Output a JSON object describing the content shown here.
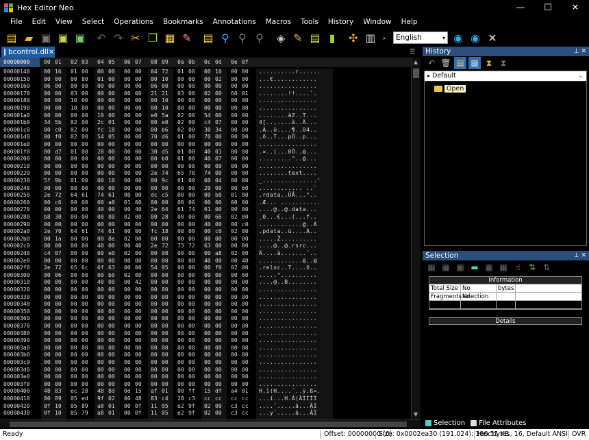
{
  "window": {
    "title": "Hex Editor Neo",
    "minimize": "—",
    "maximize": "☐",
    "close": "✕"
  },
  "menu": [
    "File",
    "Edit",
    "View",
    "Select",
    "Operations",
    "Bookmarks",
    "Annotations",
    "Macros",
    "Tools",
    "History",
    "Window",
    "Help"
  ],
  "toolbar": {
    "language": "English",
    "icons": [
      "new-file-icon",
      "open-folder-icon",
      "save-icon",
      "save-all-icon",
      "save-as-icon",
      "undo-icon",
      "redo-icon",
      "cut-icon",
      "copy-icon",
      "paste-icon",
      "erase-icon",
      "find-icon",
      "find-next-icon",
      "find-prev-icon",
      "replace-icon",
      "fill-icon",
      "edit-icon",
      "bookmark-icon",
      "goto-icon",
      "collapse-icon",
      "view-mode-icon",
      "language-icon",
      "globe-icon",
      "globe-update-icon",
      "settings-tools-icon"
    ]
  },
  "document": {
    "tab_label": "bcontrol.dll",
    "close": "✕"
  },
  "hex": {
    "header_offset": "00000000",
    "columns": [
      "00",
      "01",
      "02",
      "03",
      "04",
      "05",
      "06",
      "07",
      "08",
      "09",
      "0a",
      "0b",
      "0c",
      "0d",
      "0e",
      "0f"
    ],
    "rows": [
      {
        "o": "00000140",
        "b": "00 16 01 00 00 00 00 00 04 72 01 00 00 10 00 00",
        "a": "..........r......"
      },
      {
        "o": "00000150",
        "b": "00 00 00 80 01 00 00 00 00 10 00 00 00 02 00 00",
        "a": "...€............"
      },
      {
        "o": "00000160",
        "b": "06 00 00 00 00 00 00 00 06 00 00 00 00 00 00 00",
        "a": "................"
      },
      {
        "o": "00000170",
        "b": "00 00 03 00 00 00 00 00 21 21 03 00 02 00 60 01",
        "a": "........!!....`."
      },
      {
        "o": "00000180",
        "b": "00 00 10 00 00 00 00 00 00 10 00 00 00 00 00 00",
        "a": "................"
      },
      {
        "o": "00000190",
        "b": "00 00 10 00 00 00 00 00 00 10 00 00 00 00 00 00",
        "a": "................"
      },
      {
        "o": "000001a0",
        "b": "00 00 00 00 10 00 00 00 e0 5a 02 00 54 00 00 00",
        "a": "........àZ..T..."
      },
      {
        "o": "000001b0",
        "b": "34 5b 02 00 2c 01 00 00 00 e0 02 00 c4 07 00 00",
        "a": "4[..,....à..Ä..."
      },
      {
        "o": "000001c0",
        "b": "00 c0 02 00 fc 18 00 00 00 b6 02 00 30 34 00 00",
        "a": ".À..ü....¶..04.."
      },
      {
        "o": "000001d0",
        "b": "00 f0 02 00 54 05 00 00 70 d6 01 00 70 00 00 00",
        "a": ".ð..T...pÖ..p..."
      },
      {
        "o": "000001e0",
        "b": "00 00 00 00 00 00 00 00 00 00 00 00 00 00 00 00",
        "a": "................"
      },
      {
        "o": "000001f0",
        "b": "00 d7 01 00 28 00 00 00 30 d5 01 00 40 01 00 00",
        "a": ".×..(...0Õ..@..."
      },
      {
        "o": "00000200",
        "b": "00 00 00 00 00 00 00 00 00 b0 01 00 40 07 00 00",
        "a": ".........°..@..."
      },
      {
        "o": "00000210",
        "b": "00 00 00 00 00 00 00 00 00 00 00 00 00 00 00 00",
        "a": "................"
      },
      {
        "o": "00000220",
        "b": "00 00 00 00 00 00 00 00 2e 74 65 78 74 00 00 00",
        "a": "........text...."
      },
      {
        "o": "00000230",
        "b": "5f 9b 01 00 00 10 00 00 00 9c 01 00 00 04 00 00",
        "a": "_...............'"
      },
      {
        "o": "00000240",
        "b": "00 00 00 00 00 00 00 00 00 00 00 00 20 00 00 60",
        "a": "............ ..`"
      },
      {
        "o": "00000250",
        "b": "2e 72 64 61 74 61 00 00 dc c5 00 00 00 b0 01 00",
        "a": ".rdata..ÜÅ...°.."
      },
      {
        "o": "00000260",
        "b": "00 c6 00 00 00 a0 01 00 00 00 00 00 00 00 00 00",
        "a": ".Æ... ..........."
      },
      {
        "o": "00000270",
        "b": "00 00 00 00 40 00 00 40 2e 64 61 74 61 00 00 00",
        "a": "....@..@.data..."
      },
      {
        "o": "00000280",
        "b": "b8 30 00 00 00 80 02 00 00 28 00 00 00 66 02 00",
        "a": "¸0...€...(...f.."
      },
      {
        "o": "00000290",
        "b": "00 00 00 00 00 00 00 00 00 00 00 00 40 00 00 c0",
        "a": "............@..À"
      },
      {
        "o": "000002a0",
        "b": "2e 70 64 61 74 61 00 00 fc 18 00 00 00 c0 02 00",
        "a": ".pdata..ü....À.."
      },
      {
        "o": "000002b0",
        "b": "00 1a 00 00 00 8e 02 00 00 00 00 00 00 00 00 00",
        "a": ".....Ž.........."
      },
      {
        "o": "000002c0",
        "b": "00 00 00 00 40 00 00 40 2e 72 73 72 63 00 00 00",
        "a": "....@..@.rsrc..."
      },
      {
        "o": "000002d0",
        "b": "c4 07 00 00 00 e0 02 00 00 08 00 00 00 a8 02 00",
        "a": "Ä....à.......¨.."
      },
      {
        "o": "000002e0",
        "b": "00 00 00 00 00 00 00 00 00 00 00 00 40 00 00 40",
        "a": "............@..@"
      },
      {
        "o": "000002f0",
        "b": "2e 72 65 6c 6f 63 00 00 54 05 00 00 00 f0 02 00",
        "a": ".reloc..T....ð.."
      },
      {
        "o": "00000300",
        "b": "00 06 00 00 00 b0 02 00 00 00 00 00 00 00 00 00",
        "a": ".....°.........."
      },
      {
        "o": "00000310",
        "b": "00 00 00 00 40 00 00 42 00 00 00 00 00 00 00 00",
        "a": "....@..B........"
      },
      {
        "o": "00000320",
        "b": "00 00 00 00 00 00 00 00 00 00 00 00 00 00 00 00",
        "a": "................"
      },
      {
        "o": "00000330",
        "b": "00 00 00 00 00 00 00 00 00 00 00 00 00 00 00 00",
        "a": "................"
      },
      {
        "o": "00000340",
        "b": "00 00 00 00 00 00 00 00 00 00 00 00 00 00 00 00",
        "a": "................"
      },
      {
        "o": "00000350",
        "b": "00 00 00 00 00 00 00 00 00 00 00 00 00 00 00 00",
        "a": "................"
      },
      {
        "o": "00000360",
        "b": "00 00 00 00 00 00 00 00 00 00 00 00 00 00 00 00",
        "a": "................"
      },
      {
        "o": "00000370",
        "b": "00 00 00 00 00 00 00 00 00 00 00 00 00 00 00 00",
        "a": "................"
      },
      {
        "o": "00000380",
        "b": "00 00 00 00 00 00 00 00 00 00 00 00 00 00 00 00",
        "a": "................"
      },
      {
        "o": "00000390",
        "b": "00 00 00 00 00 00 00 00 00 00 00 00 00 00 00 00",
        "a": "................"
      },
      {
        "o": "000003a0",
        "b": "00 00 00 00 00 00 00 00 00 00 00 00 00 00 00 00",
        "a": "................"
      },
      {
        "o": "000003b0",
        "b": "00 00 00 00 00 00 00 00 00 00 00 00 00 00 00 00",
        "a": "................"
      },
      {
        "o": "000003c0",
        "b": "00 00 00 00 00 00 00 00 00 00 00 00 00 00 00 00",
        "a": "................"
      },
      {
        "o": "000003d0",
        "b": "00 00 00 00 00 00 00 00 00 00 00 00 00 00 00 00",
        "a": "................"
      },
      {
        "o": "000003e0",
        "b": "00 00 00 00 00 00 00 00 00 00 00 00 00 00 00 00",
        "a": "................"
      },
      {
        "o": "000003f0",
        "b": "00 00 00 00 00 00 00 00 00 00 00 00 00 00 00 00",
        "a": "................"
      },
      {
        "o": "00000400",
        "b": "48 83 ec 28 48 8d 0d 15 af 01 00 ff 15 df a4 01",
        "a": "H.ì(H....¯..ÿ.ß¤."
      },
      {
        "o": "00000410",
        "b": "00 89 05 ed 9f 02 00 48 83 c4 28 c3 cc cc cc cc",
        "a": "...í...H.Ä(ÃÌÌÌÌ"
      },
      {
        "o": "00000420",
        "b": "0f 10 05 89 a8 01 00 0f 11 05 e2 9f 02 00 c3 cc",
        "a": "....¨.....â...ÃÌ"
      },
      {
        "o": "00000430",
        "b": "0f 10 05 79 a8 01 00 0f 11 05 e2 9f 02 00 c3 cc",
        "a": "...y¨.....â...ÃÌ"
      }
    ]
  },
  "history": {
    "title": "History",
    "tab": "Default",
    "items": [
      "Open"
    ]
  },
  "selection": {
    "title": "Selection",
    "info_header": "Information",
    "rows": [
      {
        "label": "Total Size",
        "value": "No selection",
        "unit": "bytes"
      },
      {
        "label": "Fragments",
        "value": "No selection",
        "unit": ""
      }
    ],
    "details_header": "Details"
  },
  "bottom_tabs": [
    "Selection",
    "File Attributes"
  ],
  "status": {
    "ready": "Ready",
    "offset": "Offset: 00000000 (0)",
    "size": "Size: 0x0002ea30 (191,024): 186.55 KB",
    "mode": "Hex bytes, 16, Default ANSI",
    "ovr": "OVR"
  }
}
